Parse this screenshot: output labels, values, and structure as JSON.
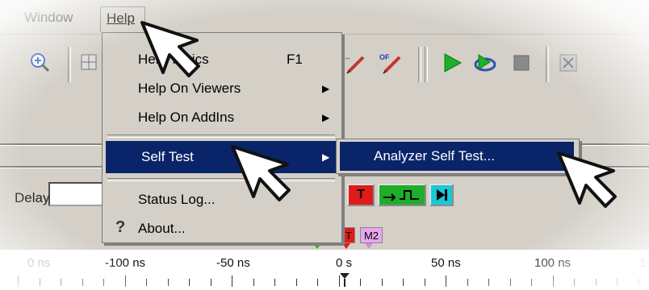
{
  "menubar": {
    "window_label": "Window",
    "help_label": "Help"
  },
  "help_menu": {
    "items": [
      {
        "label": "Help Topics",
        "shortcut": "F1"
      },
      {
        "label": "Help On Viewers",
        "arrow": "▶"
      },
      {
        "label": "Help On AddIns",
        "arrow": "▶"
      },
      {
        "label": "Self Test",
        "arrow": "▶"
      },
      {
        "label": "Status Log..."
      },
      {
        "label": "About..."
      }
    ]
  },
  "submenu": {
    "items": [
      {
        "label": "Analyzer Self Test..."
      }
    ]
  },
  "trigger": {
    "delay_label": "Delay",
    "delay_value": "",
    "t_label": "T"
  },
  "markers": {
    "t": "T",
    "m2": "M2"
  },
  "ruler": {
    "labels": [
      "0 ns",
      "-100 ns",
      "-50 ns",
      "0 s",
      "50 ns",
      "100 ns",
      "1"
    ]
  },
  "colors": {
    "menu_highlight": "#0a246a",
    "play_green": "#1fae2a",
    "trigger_red": "#e01b1b",
    "marker_magenta": "#e7a6ef"
  }
}
